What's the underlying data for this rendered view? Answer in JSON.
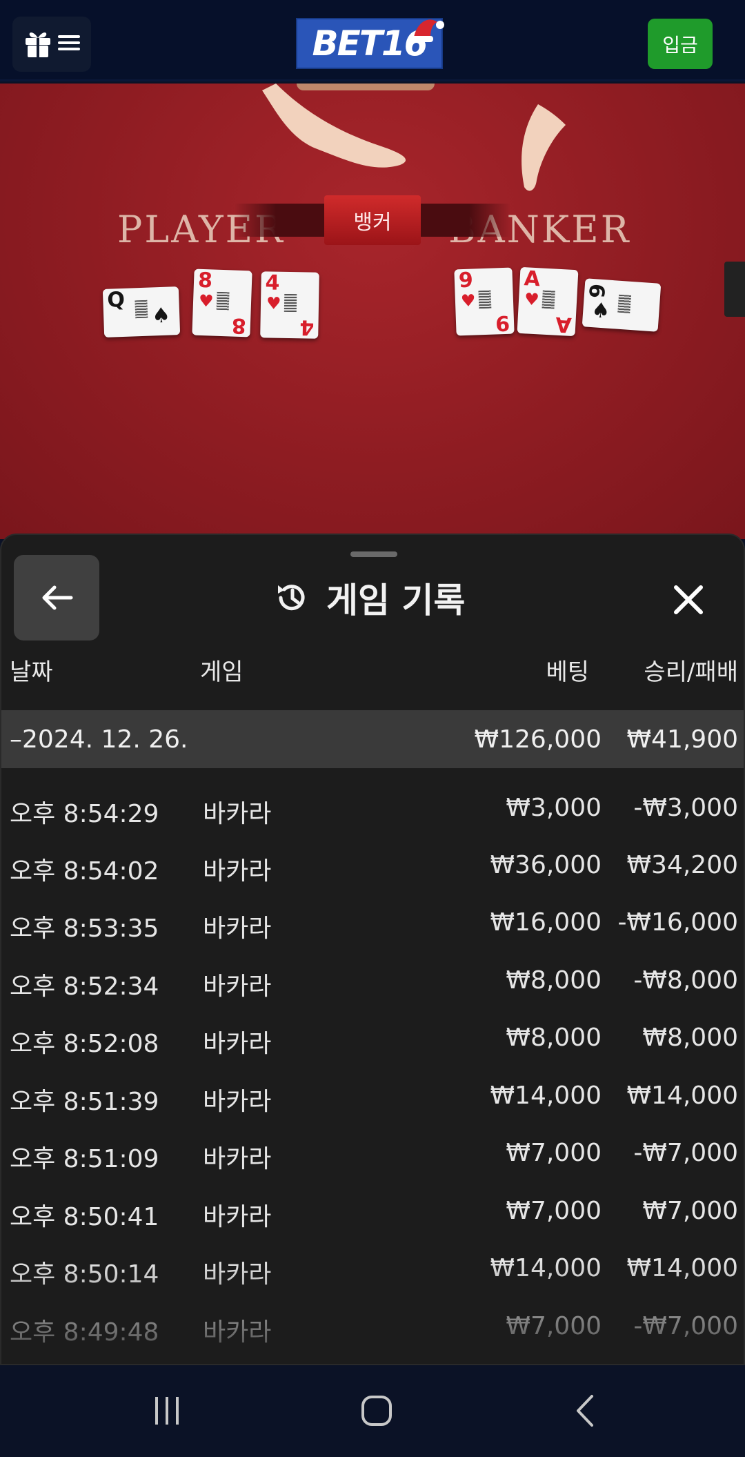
{
  "header": {
    "logo_text": "BET16",
    "deposit_label": "입금",
    "colors": {
      "deposit": "#1f9b2b",
      "logo_bg": "#2a55b8"
    }
  },
  "table": {
    "result_banner": "뱅커",
    "player_label": "PLAYER",
    "banker_label": "BANKER",
    "player_cards": [
      {
        "rank": "Q",
        "suit": "♠"
      },
      {
        "rank": "8",
        "suit": "♥"
      },
      {
        "rank": "4",
        "suit": "♥"
      }
    ],
    "banker_cards": [
      {
        "rank": "9",
        "suit": "♥"
      },
      {
        "rank": "A",
        "suit": "♥"
      },
      {
        "rank": "6",
        "suit": "♠"
      }
    ]
  },
  "history": {
    "title": "게임 기록",
    "columns": {
      "date": "날짜",
      "game": "게임",
      "bet": "베팅",
      "result": "승리/패배"
    },
    "date_group": {
      "date": "–2024. 12. 26.",
      "bet_total": "₩126,000",
      "result_total": "₩41,900"
    },
    "rows": [
      {
        "time": "오후 8:54:29",
        "game": "바카라",
        "bet": "₩3,000",
        "result": "-₩3,000"
      },
      {
        "time": "오후 8:54:02",
        "game": "바카라",
        "bet": "₩36,000",
        "result": "₩34,200"
      },
      {
        "time": "오후 8:53:35",
        "game": "바카라",
        "bet": "₩16,000",
        "result": "-₩16,000"
      },
      {
        "time": "오후 8:52:34",
        "game": "바카라",
        "bet": "₩8,000",
        "result": "-₩8,000"
      },
      {
        "time": "오후 8:52:08",
        "game": "바카라",
        "bet": "₩8,000",
        "result": "₩8,000"
      },
      {
        "time": "오후 8:51:39",
        "game": "바카라",
        "bet": "₩14,000",
        "result": "₩14,000"
      },
      {
        "time": "오후 8:51:09",
        "game": "바카라",
        "bet": "₩7,000",
        "result": "-₩7,000"
      },
      {
        "time": "오후 8:50:41",
        "game": "바카라",
        "bet": "₩7,000",
        "result": "₩7,000"
      },
      {
        "time": "오후 8:50:14",
        "game": "바카라",
        "bet": "₩14,000",
        "result": "₩14,000"
      },
      {
        "time": "오후 8:49:48",
        "game": "바카라",
        "bet": "₩7,000",
        "result": "-₩7,000"
      }
    ]
  },
  "icons": {
    "menu": [
      "gift-icon",
      "hamburger-icon"
    ],
    "back": "arrow-left-icon",
    "title": "history-icon",
    "close": "close-icon",
    "nav": [
      "recents-icon",
      "home-icon",
      "back-nav-icon"
    ]
  }
}
